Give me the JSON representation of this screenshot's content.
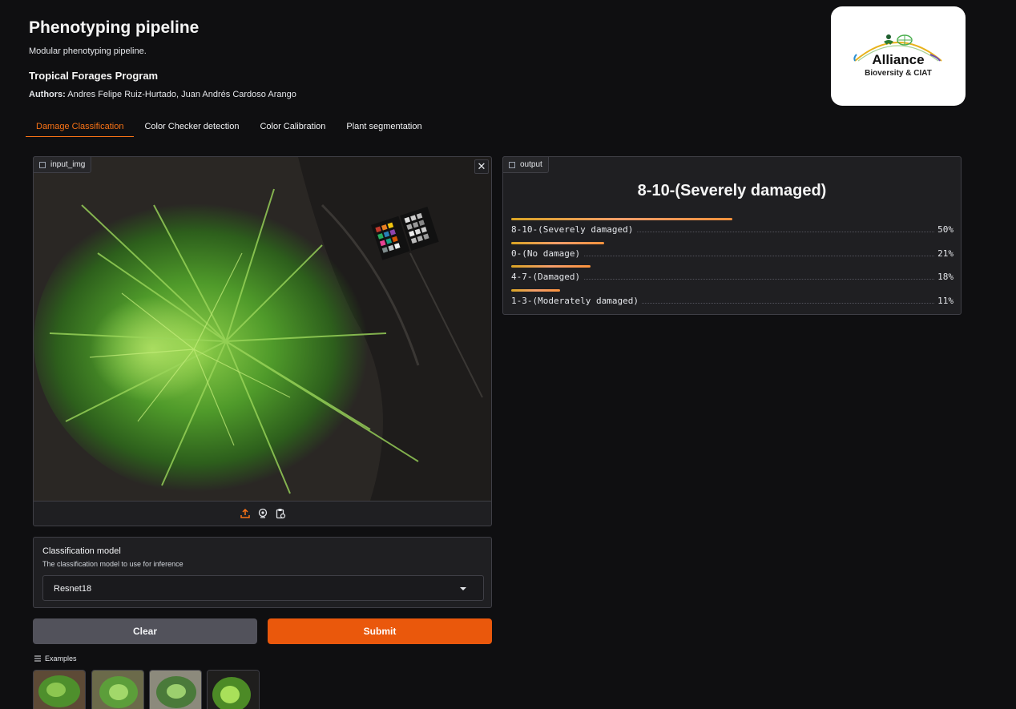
{
  "header": {
    "title": "Phenotyping pipeline",
    "subtitle": "Modular phenotyping pipeline.",
    "program": "Tropical Forages Program",
    "authors_label": "Authors:",
    "authors": "Andres Felipe Ruiz-Hurtado, Juan Andrés Cardoso Arango"
  },
  "logo": {
    "name": "Alliance",
    "sub": "Bioversity & CIAT"
  },
  "tabs": [
    {
      "label": "Damage Classification",
      "active": true
    },
    {
      "label": "Color Checker detection",
      "active": false
    },
    {
      "label": "Color Calibration",
      "active": false
    },
    {
      "label": "Plant segmentation",
      "active": false
    }
  ],
  "input": {
    "label": "input_img",
    "close": "✕"
  },
  "output": {
    "label": "output",
    "prediction": "8-10-(Severely damaged)",
    "confidences": [
      {
        "label": "8-10-(Severely damaged)",
        "pct": "50%",
        "value": 0.5
      },
      {
        "label": "0-(No damage)",
        "pct": "21%",
        "value": 0.21
      },
      {
        "label": "4-7-(Damaged)",
        "pct": "18%",
        "value": 0.18
      },
      {
        "label": "1-3-(Moderately damaged)",
        "pct": "11%",
        "value": 0.11
      }
    ]
  },
  "model": {
    "label": "Classification model",
    "info": "The classification model to use for inference",
    "value": "Resnet18"
  },
  "buttons": {
    "clear": "Clear",
    "submit": "Submit"
  },
  "examples": {
    "label": "Examples"
  },
  "colors": {
    "accent": "#ea580c",
    "tab_active": "#f97316",
    "background": "#0f0f11",
    "panel": "#1f1f22"
  }
}
